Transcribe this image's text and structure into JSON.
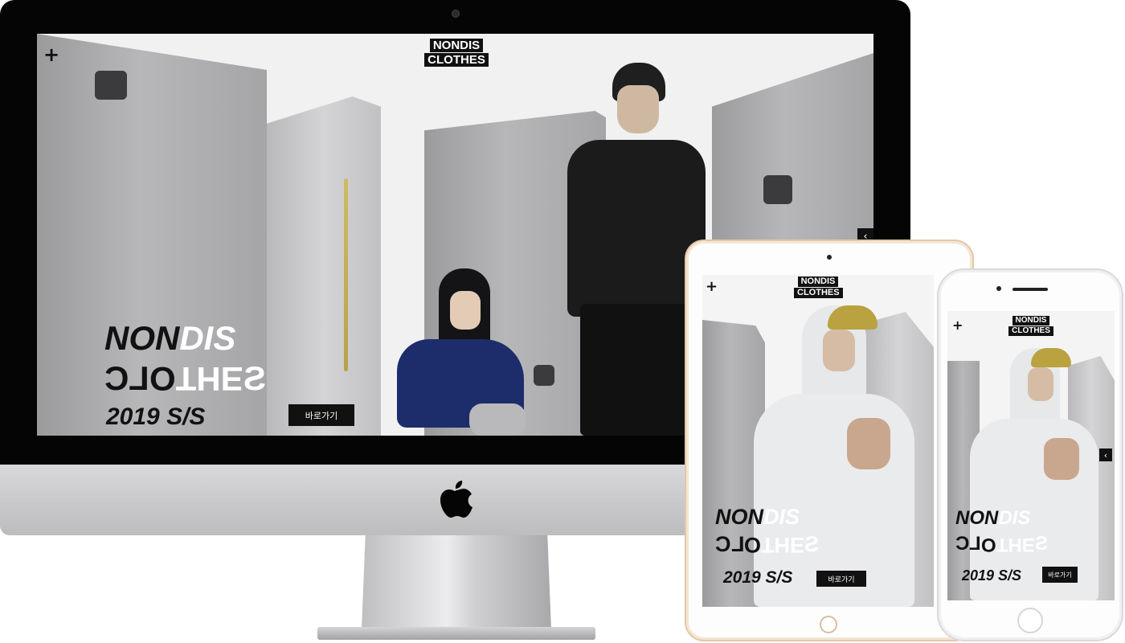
{
  "brand": {
    "logo_line1": "NONDIS",
    "logo_line2": "CLOTHES"
  },
  "hero": {
    "word_black": "NON",
    "word_white": "DIS",
    "mirror_line": [
      "C",
      "L",
      "O",
      "T",
      "H",
      "E",
      "S"
    ],
    "season": "2019 S/S",
    "cta_label": "바로가기"
  },
  "icons": {
    "menu": "+",
    "prev": "‹"
  },
  "colors": {
    "text_dark": "#111111",
    "text_light": "#ffffff",
    "ipad_frame": "#e2c8a6"
  }
}
